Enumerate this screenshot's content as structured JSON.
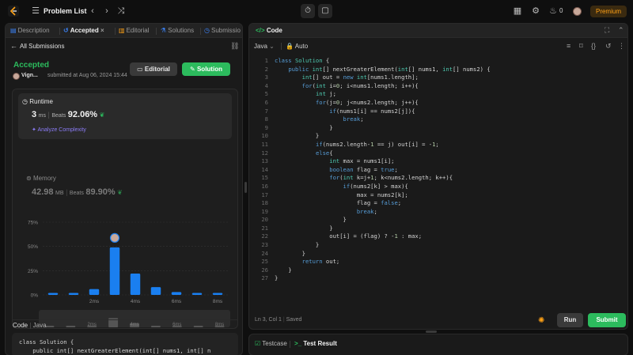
{
  "header": {
    "title": "Problem List",
    "streak": "0",
    "premium": "Premium",
    "icons": [
      "list-icon",
      "chevron-left-icon",
      "chevron-right-icon",
      "shuffle-icon",
      "timer-icon",
      "note-icon",
      "grid-icon",
      "gear-icon",
      "fire-icon"
    ]
  },
  "left_tabs": [
    {
      "label": "Description",
      "icon": "description-icon"
    },
    {
      "label": "Accepted",
      "icon": "history-icon",
      "active": true
    },
    {
      "label": "Editorial",
      "icon": "book-icon"
    },
    {
      "label": "Solutions",
      "icon": "flask-icon"
    },
    {
      "label": "Submissio",
      "icon": "clock-icon"
    }
  ],
  "submission": {
    "back_label": "All Submissions",
    "status": "Accepted",
    "user": "Vign...",
    "submitted_text": "submitted at Aug 06, 2024 15:44",
    "editorial_btn": "Editorial",
    "solution_btn": "Solution"
  },
  "runtime": {
    "title": "Runtime",
    "value": "3",
    "unit": "ms",
    "beats_label": "Beats",
    "beats": "92.06%",
    "analyze": "Analyze Complexity"
  },
  "memory": {
    "title": "Memory",
    "value": "42.98",
    "unit": "MB",
    "beats_label": "Beats",
    "beats": "89.90%"
  },
  "chart_data": {
    "type": "bar",
    "yticks": [
      "75%",
      "50%",
      "25%",
      "0%"
    ],
    "ylim": [
      0,
      75
    ],
    "xticks": [
      "2ms",
      "4ms",
      "6ms",
      "8ms"
    ],
    "values": [
      2,
      2,
      6,
      49,
      22,
      8,
      3,
      2,
      2
    ],
    "highlight_index": 3,
    "colors": {
      "bar": "#1a7ff0",
      "grid": "#333333"
    }
  },
  "code_section": {
    "label": "Code",
    "lang": "Java",
    "preview_line1": "class Solution {",
    "preview_line2": "    public int[] nextGreaterElement(int[] nums1, int[] n"
  },
  "editor": {
    "title": "Code",
    "language": "Java",
    "mode": "Auto",
    "cursor": "Ln 3, Col 1",
    "saved": "Saved",
    "run": "Run",
    "submit": "Submit",
    "lines": [
      "class Solution {",
      "    public int[] nextGreaterElement(int[] nums1, int[] nums2) {",
      "        int[] out = new int[nums1.length];",
      "        for(int i=0; i<nums1.length; i++){",
      "            int j;",
      "            for(j=0; j<nums2.length; j++){",
      "                if(nums1[i] == nums2[j]){",
      "                    break;",
      "                }",
      "            }",
      "            if(nums2.length-1 == j) out[i] = -1;",
      "            else{",
      "                int max = nums1[i];",
      "                boolean flag = true;",
      "                for(int k=j+1; k<nums2.length; k++){",
      "                    if(nums2[k] > max){",
      "                        max = nums2[k];",
      "                        flag = false;",
      "                        break;",
      "                    }",
      "                }",
      "                out[i] = (flag) ? -1 : max;",
      "            }",
      "        }",
      "        return out;",
      "    }",
      "}"
    ]
  },
  "bottom_tabs": {
    "testcase": "Testcase",
    "result": "Test Result"
  },
  "colors": {
    "accent_green": "#2cbb5d",
    "premium": "#ffa116",
    "bar_blue": "#1a7ff0"
  }
}
